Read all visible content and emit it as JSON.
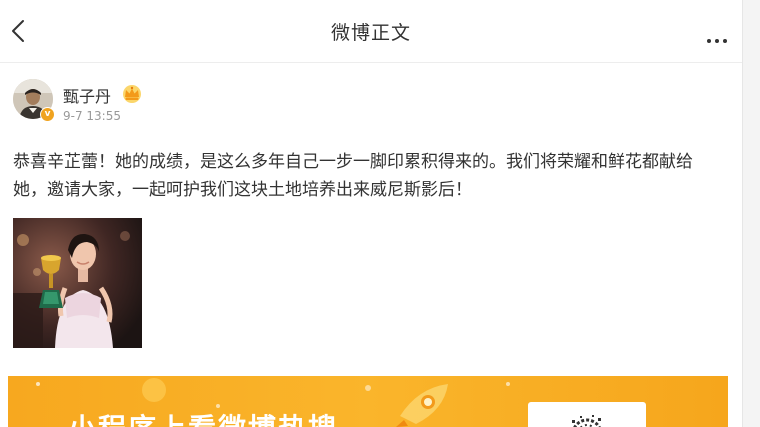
{
  "header": {
    "title": "微博正文",
    "back_icon": "chevron-left-icon",
    "more_icon": "more-horizontal-icon"
  },
  "post": {
    "author": {
      "name": "甄子丹",
      "badge_icon": "crown-icon",
      "verified_icon": "verified-v-icon",
      "verified_mark": "v"
    },
    "time": "9-7 13:55",
    "text": "恭喜辛芷蕾！她的成绩，是这么多年自己一步一脚印累积得来的。我们将荣耀和鲜花都献给她，邀请大家，一起呵护我们这块土地培养出来威尼斯影后！",
    "image": {
      "icon": "photo-thumbnail"
    }
  },
  "banner": {
    "text": "小程序上看微博热搜",
    "colors": {
      "background": "#f7a81f",
      "accent": "#ffffff"
    }
  },
  "colors": {
    "text": "#333333",
    "muted": "#999999",
    "page_bg": "#f2f2f2",
    "gold": "#f0a31f"
  }
}
